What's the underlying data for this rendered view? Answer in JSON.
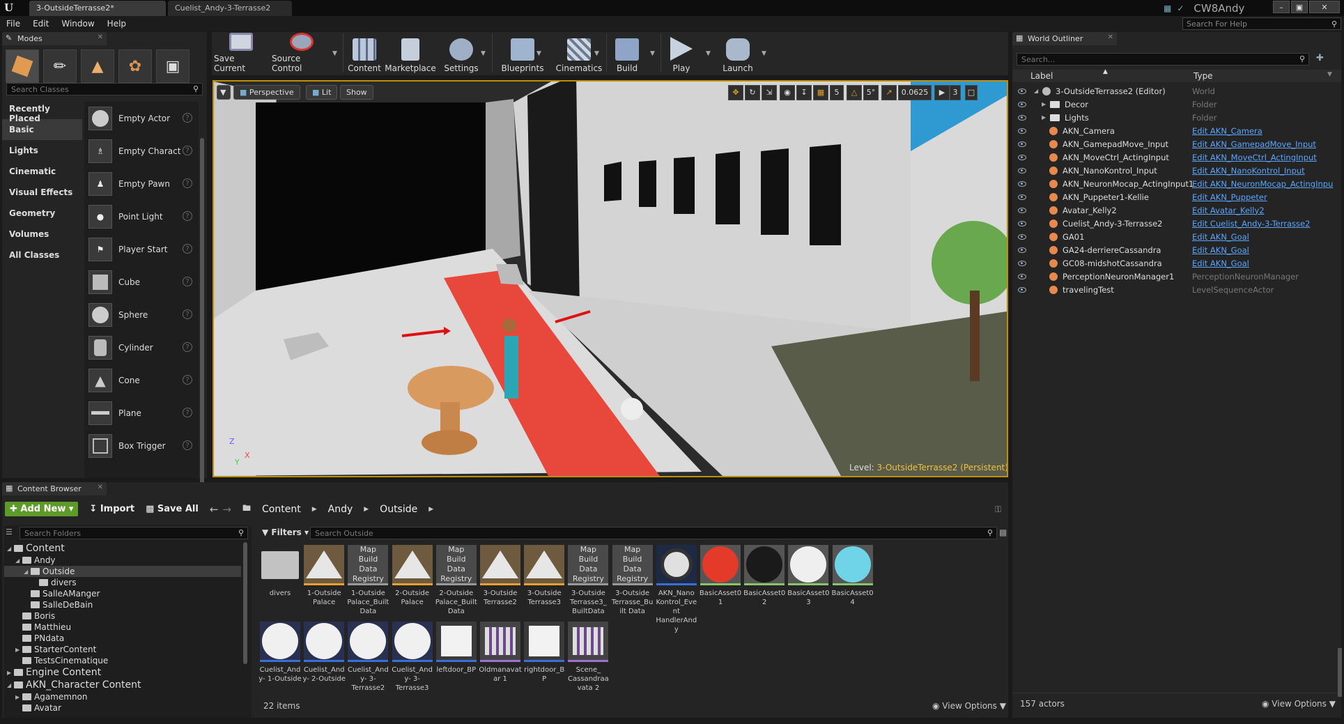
{
  "title_bar": {
    "tabs": [
      "3-OutsideTerrasse2*",
      "Cuelist_Andy-3-Terrasse2"
    ],
    "user": "CW8Andy"
  },
  "menu": [
    "File",
    "Edit",
    "Window",
    "Help"
  ],
  "help_search_placeholder": "Search For Help",
  "modes": {
    "tab_label": "Modes",
    "search_placeholder": "Search Classes",
    "categories": [
      "Recently Placed",
      "Basic",
      "Lights",
      "Cinematic",
      "Visual Effects",
      "Geometry",
      "Volumes",
      "All Classes"
    ],
    "active_category": "Basic",
    "actors": [
      "Empty Actor",
      "Empty Charact",
      "Empty Pawn",
      "Point Light",
      "Player Start",
      "Cube",
      "Sphere",
      "Cylinder",
      "Cone",
      "Plane",
      "Box Trigger"
    ]
  },
  "toolbar": {
    "buttons": [
      "Save Current",
      "Source Control",
      "Content",
      "Marketplace",
      "Settings",
      "Blueprints",
      "Cinematics",
      "Build",
      "Play",
      "Launch"
    ]
  },
  "viewport": {
    "perspective_label": "Perspective",
    "lit_label": "Lit",
    "show_label": "Show",
    "grid_snap": "5",
    "rotation_snap": "5°",
    "scale_snap": "0.0625",
    "camera_speed": "3",
    "level_label": "Level:",
    "level_name": "3-OutsideTerrasse2 (Persistent)",
    "axis_z": "Z",
    "axis_x": "X",
    "axis_y": "Y"
  },
  "outliner": {
    "tab_label": "World Outliner",
    "search_placeholder": "Search...",
    "col_label": "Label",
    "col_type": "Type",
    "rows": [
      {
        "label": "3-OutsideTerrasse2 (Editor)",
        "type": "World",
        "link": false,
        "indent": 1
      },
      {
        "label": "Decor",
        "type": "Folder",
        "link": false,
        "indent": 2
      },
      {
        "label": "Lights",
        "type": "Folder",
        "link": false,
        "indent": 2
      },
      {
        "label": "AKN_Camera",
        "type": "Edit AKN_Camera",
        "link": true,
        "indent": 3
      },
      {
        "label": "AKN_GamepadMove_Input",
        "type": "Edit AKN_GamepadMove_Input",
        "link": true,
        "indent": 3
      },
      {
        "label": "AKN_MoveCtrl_ActingInput",
        "type": "Edit AKN_MoveCtrl_ActingInput",
        "link": true,
        "indent": 3
      },
      {
        "label": "AKN_NanoKontrol_Input",
        "type": "Edit AKN_NanoKontrol_Input",
        "link": true,
        "indent": 3
      },
      {
        "label": "AKN_NeuronMocap_ActingInput1",
        "type": "Edit AKN_NeuronMocap_ActingInpu",
        "link": true,
        "indent": 3
      },
      {
        "label": "AKN_Puppeter1-Kellie",
        "type": "Edit AKN_Puppeter",
        "link": true,
        "indent": 3
      },
      {
        "label": "Avatar_Kelly2",
        "type": "Edit Avatar_Kelly2",
        "link": true,
        "indent": 3
      },
      {
        "label": "Cuelist_Andy-3-Terrasse2",
        "type": "Edit Cuelist_Andy-3-Terrasse2",
        "link": true,
        "indent": 3
      },
      {
        "label": "GA01",
        "type": "Edit AKN_Goal",
        "link": true,
        "indent": 3
      },
      {
        "label": "GA24-derriereCassandra",
        "type": "Edit AKN_Goal",
        "link": true,
        "indent": 3
      },
      {
        "label": "GC08-midshotCassandra",
        "type": "Edit AKN_Goal",
        "link": true,
        "indent": 3
      },
      {
        "label": "PerceptionNeuronManager1",
        "type": "PerceptionNeuronManager",
        "link": false,
        "indent": 3
      },
      {
        "label": "travelingTest",
        "type": "LevelSequenceActor",
        "link": false,
        "indent": 3
      }
    ],
    "actor_count": "157 actors",
    "view_options": "View Options"
  },
  "content_browser": {
    "tab_label": "Content Browser",
    "add_new": "Add New",
    "import": "Import",
    "save_all": "Save All",
    "breadcrumb": [
      "Content",
      "Andy",
      "Outside"
    ],
    "search_folders_placeholder": "Search Folders",
    "filters": "Filters",
    "search_placeholder": "Search Outside",
    "tree": [
      {
        "label": "Content",
        "indent": 0,
        "big": true
      },
      {
        "label": "Andy",
        "indent": 1,
        "big": false
      },
      {
        "label": "Outside",
        "indent": 2,
        "big": false
      },
      {
        "label": "divers",
        "indent": 3,
        "big": false
      },
      {
        "label": "SalleAManger",
        "indent": 2,
        "big": false
      },
      {
        "label": "SalleDeBain",
        "indent": 2,
        "big": false
      },
      {
        "label": "Boris",
        "indent": 1,
        "big": false
      },
      {
        "label": "Matthieu",
        "indent": 1,
        "big": false
      },
      {
        "label": "PNdata",
        "indent": 1,
        "big": false
      },
      {
        "label": "StarterContent",
        "indent": 1,
        "big": false
      },
      {
        "label": "TestsCinematique",
        "indent": 1,
        "big": false
      },
      {
        "label": "Engine Content",
        "indent": 0,
        "big": true
      },
      {
        "label": "AKN_Character Content",
        "indent": 0,
        "big": true
      },
      {
        "label": "Agamemnon",
        "indent": 1,
        "big": false
      },
      {
        "label": "Avatar",
        "indent": 1,
        "big": false
      }
    ],
    "assets_row1": [
      {
        "name": "divers",
        "kind": "folder"
      },
      {
        "name": "1-Outside Palace",
        "kind": "map"
      },
      {
        "name": "1-Outside Palace_Built Data",
        "kind": "registry"
      },
      {
        "name": "2-Outside Palace",
        "kind": "map"
      },
      {
        "name": "2-Outside Palace_Built Data",
        "kind": "registry"
      },
      {
        "name": "3-Outside Terrasse2",
        "kind": "map"
      },
      {
        "name": "3-Outside Terrasse3",
        "kind": "map"
      },
      {
        "name": "3-Outside Terrasse3_ BuiltData",
        "kind": "registry"
      },
      {
        "name": "3-Outside Terrasse_Built Data",
        "kind": "registry"
      },
      {
        "name": "AKN_Nano Kontrol_Event HandlerAndy",
        "kind": "bp"
      },
      {
        "name": "BasicAsset01",
        "kind": "red"
      },
      {
        "name": "BasicAsset02",
        "kind": "black"
      },
      {
        "name": "BasicAsset03",
        "kind": "white"
      },
      {
        "name": "BasicAsset04",
        "kind": "cyan"
      }
    ],
    "assets_row2": [
      {
        "name": "Cuelist_Andy- 1-Outside",
        "kind": "cue"
      },
      {
        "name": "Cuelist_Andy- 2-Outside",
        "kind": "cue"
      },
      {
        "name": "Cuelist_Andy- 3-Terrasse2",
        "kind": "cue"
      },
      {
        "name": "Cuelist_Andy- 3-Terrasse3",
        "kind": "cue"
      },
      {
        "name": "leftdoor_BP",
        "kind": "box"
      },
      {
        "name": "Oldmanavatar 1",
        "kind": "anim"
      },
      {
        "name": "rightdoor_BP",
        "kind": "box"
      },
      {
        "name": "Scene_ Cassandraavata 2",
        "kind": "anim"
      }
    ],
    "registry_label": "Map Build Data Registry",
    "item_count": "22 items",
    "view_options": "View Options"
  },
  "colors": {
    "accent_yellow": "#c09000",
    "link_blue": "#5aa5ff",
    "green_button": "#5e9a2a",
    "carpet_red": "#e84a3e"
  }
}
